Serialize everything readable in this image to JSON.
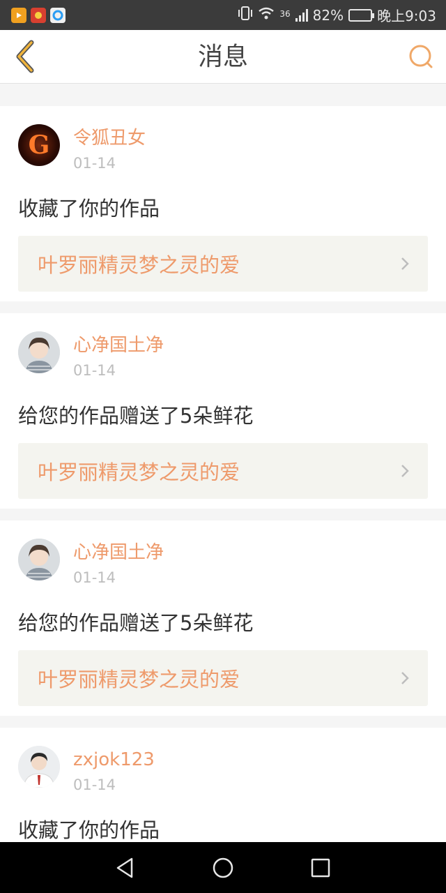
{
  "status_bar": {
    "network": "36",
    "battery": "82%",
    "time": "晚上9:03",
    "battery_level": 0.82
  },
  "header": {
    "title": "消息"
  },
  "messages": [
    {
      "username": "令狐丑女",
      "date": "01-14",
      "action": "收藏了你的作品",
      "work_title": "叶罗丽精灵梦之灵的爱",
      "avatar_letter": "G"
    },
    {
      "username": "心净国土净",
      "date": "01-14",
      "action": "给您的作品赠送了5朵鲜花",
      "work_title": "叶罗丽精灵梦之灵的爱"
    },
    {
      "username": "心净国土净",
      "date": "01-14",
      "action": "给您的作品赠送了5朵鲜花",
      "work_title": "叶罗丽精灵梦之灵的爱"
    },
    {
      "username": "zxjok123",
      "date": "01-14",
      "action": "收藏了你的作品"
    }
  ],
  "colors": {
    "accent": "#ee9a6b",
    "header_back": "#f0b43c",
    "card_link_bg": "#f4f4ef"
  },
  "icons": {
    "back": "back-arrow-icon",
    "search": "search-icon",
    "chevron": "chevron-right-icon",
    "nav_back": "triangle-back-icon",
    "nav_home": "circle-home-icon",
    "nav_recent": "square-recent-icon"
  }
}
